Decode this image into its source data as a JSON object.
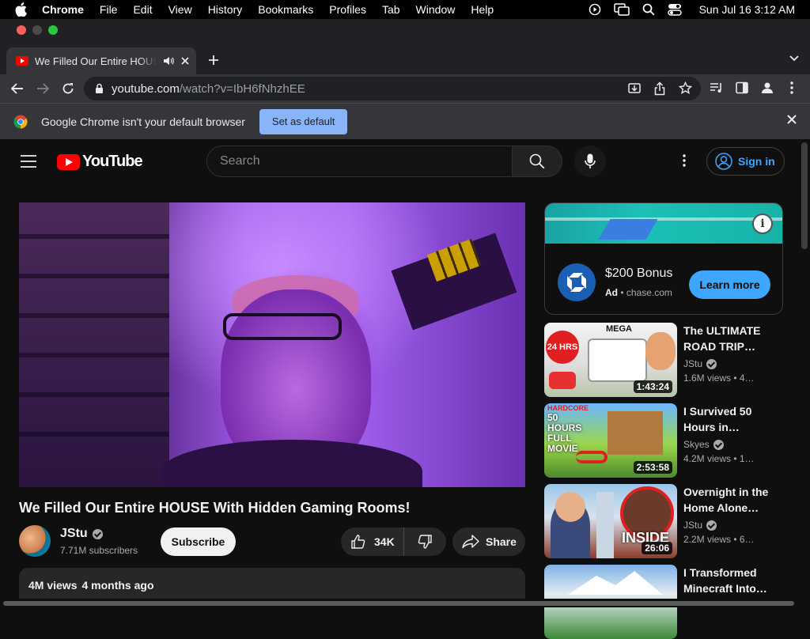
{
  "menubar": {
    "app": "Chrome",
    "items": [
      "File",
      "Edit",
      "View",
      "History",
      "Bookmarks",
      "Profiles",
      "Tab",
      "Window",
      "Help"
    ],
    "clock": "Sun Jul 16  3:12 AM"
  },
  "tab": {
    "title": "We Filled Our Entire HOUSE With Hidden Gaming Rooms! - YouTube"
  },
  "omnibox": {
    "domain": "youtube.com",
    "path": "/watch?v=IbH6fNhzhEE"
  },
  "infobar": {
    "message": "Google Chrome isn't your default browser",
    "button": "Set as default"
  },
  "youtube": {
    "logo_text": "YouTube",
    "search_placeholder": "Search",
    "signin": "Sign in"
  },
  "video": {
    "title": "We Filled Our Entire HOUSE With Hidden Gaming Rooms!",
    "channel": "JStu",
    "subscribers": "7.71M subscribers",
    "subscribe": "Subscribe",
    "likes": "34K",
    "share": "Share",
    "views": "4M views",
    "age": "4 months ago"
  },
  "ad": {
    "headline": "$200 Bonus",
    "label": "Ad",
    "domain": "chase.com",
    "cta": "Learn more"
  },
  "recommendations": [
    {
      "title": "The ULTIMATE ROAD TRIP…",
      "channel": "JStu",
      "meta": "1.6M views • 4…",
      "duration": "1:43:24",
      "badge": "24 HRS",
      "badge2": "MEGA"
    },
    {
      "title": "I Survived 50 Hours in…",
      "channel": "Skyes",
      "meta": "4.2M views • 1…",
      "duration": "2:53:58",
      "badge": "50 HOURS FULL MOVIE",
      "badge2": "HARDCORE"
    },
    {
      "title": "Overnight in the Home Alone…",
      "channel": "JStu",
      "meta": "2.2M views • 6…",
      "duration": "26:06",
      "badge": "INSIDE"
    },
    {
      "title": "I Transformed Minecraft Into…",
      "channel": "",
      "meta": "",
      "duration": ""
    }
  ]
}
